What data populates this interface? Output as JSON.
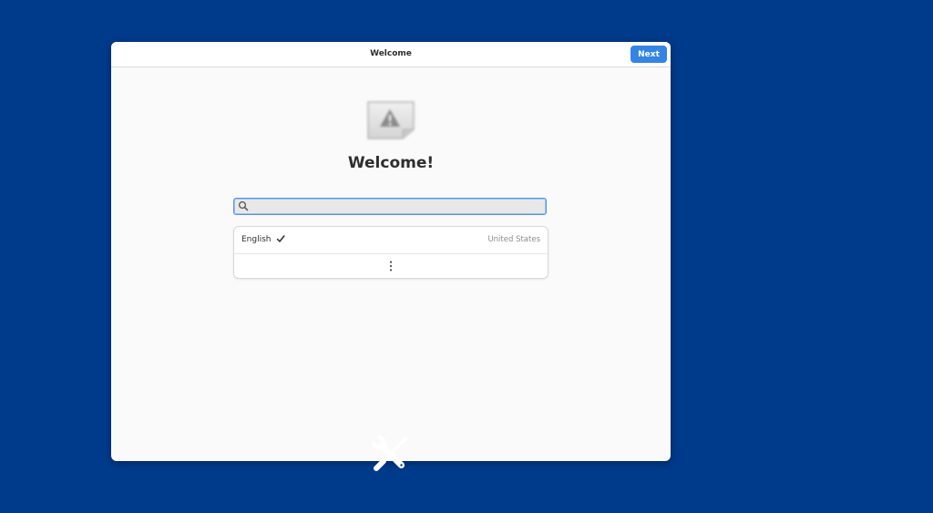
{
  "window": {
    "title": "Welcome",
    "next_label": "Next"
  },
  "main": {
    "heading": "Welcome!",
    "image_icon": "missing-image-icon",
    "search": {
      "value": "",
      "placeholder": "",
      "icon": "search-icon"
    },
    "languages": [
      {
        "name": "English",
        "selected": true,
        "region": "United States",
        "selected_icon": "check-icon"
      }
    ],
    "more_icon": "vertical-ellipsis-icon"
  },
  "desktop": {
    "background_color": "#003a8a",
    "overlay_icon": "wrench-screwdriver-icon"
  },
  "colors": {
    "accent": "#3584e4"
  }
}
